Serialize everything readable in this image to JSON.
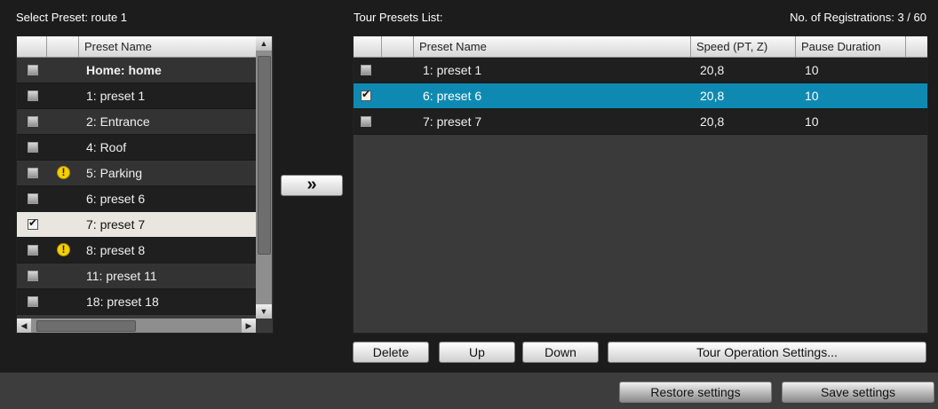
{
  "colors": {
    "background": "#1c1c1c",
    "selected_row": "#0e8ab2",
    "warning": "#f6d000",
    "panel": "#3a3a3a"
  },
  "left": {
    "title": "Select Preset: route 1",
    "columns": [
      "",
      "",
      "Preset Name"
    ],
    "rows": [
      {
        "label": "Home: home",
        "checked": false,
        "warning": false,
        "bold": true
      },
      {
        "label": "1: preset 1",
        "checked": false,
        "warning": false
      },
      {
        "label": "2: Entrance",
        "checked": false,
        "warning": false
      },
      {
        "label": "4: Roof",
        "checked": false,
        "warning": false
      },
      {
        "label": "5: Parking",
        "checked": false,
        "warning": true
      },
      {
        "label": "6: preset 6",
        "checked": false,
        "warning": false
      },
      {
        "label": "7: preset 7",
        "checked": true,
        "warning": false,
        "selected": true
      },
      {
        "label": "8: preset 8",
        "checked": false,
        "warning": true
      },
      {
        "label": "11: preset 11",
        "checked": false,
        "warning": false
      },
      {
        "label": "18: preset 18",
        "checked": false,
        "warning": false
      }
    ],
    "warning_glyph": "!"
  },
  "add_button": {
    "label": "»",
    "icon": "double-chevron-right-icon"
  },
  "right": {
    "title": "Tour Presets List:",
    "registrations": "No. of Registrations: 3 / 60",
    "columns": [
      "",
      "",
      "Preset Name",
      "Speed (PT, Z)",
      "Pause Duration"
    ],
    "rows": [
      {
        "checked": false,
        "name": "1: preset 1",
        "speed": "20,8",
        "pause": "10"
      },
      {
        "checked": true,
        "name": "6: preset 6",
        "speed": "20,8",
        "pause": "10",
        "selected": true
      },
      {
        "checked": false,
        "name": "7: preset 7",
        "speed": "20,8",
        "pause": "10"
      }
    ]
  },
  "buttons": {
    "delete": "Delete",
    "up": "Up",
    "down": "Down",
    "tour_settings": "Tour Operation Settings...",
    "restore": "Restore settings",
    "save": "Save settings"
  }
}
